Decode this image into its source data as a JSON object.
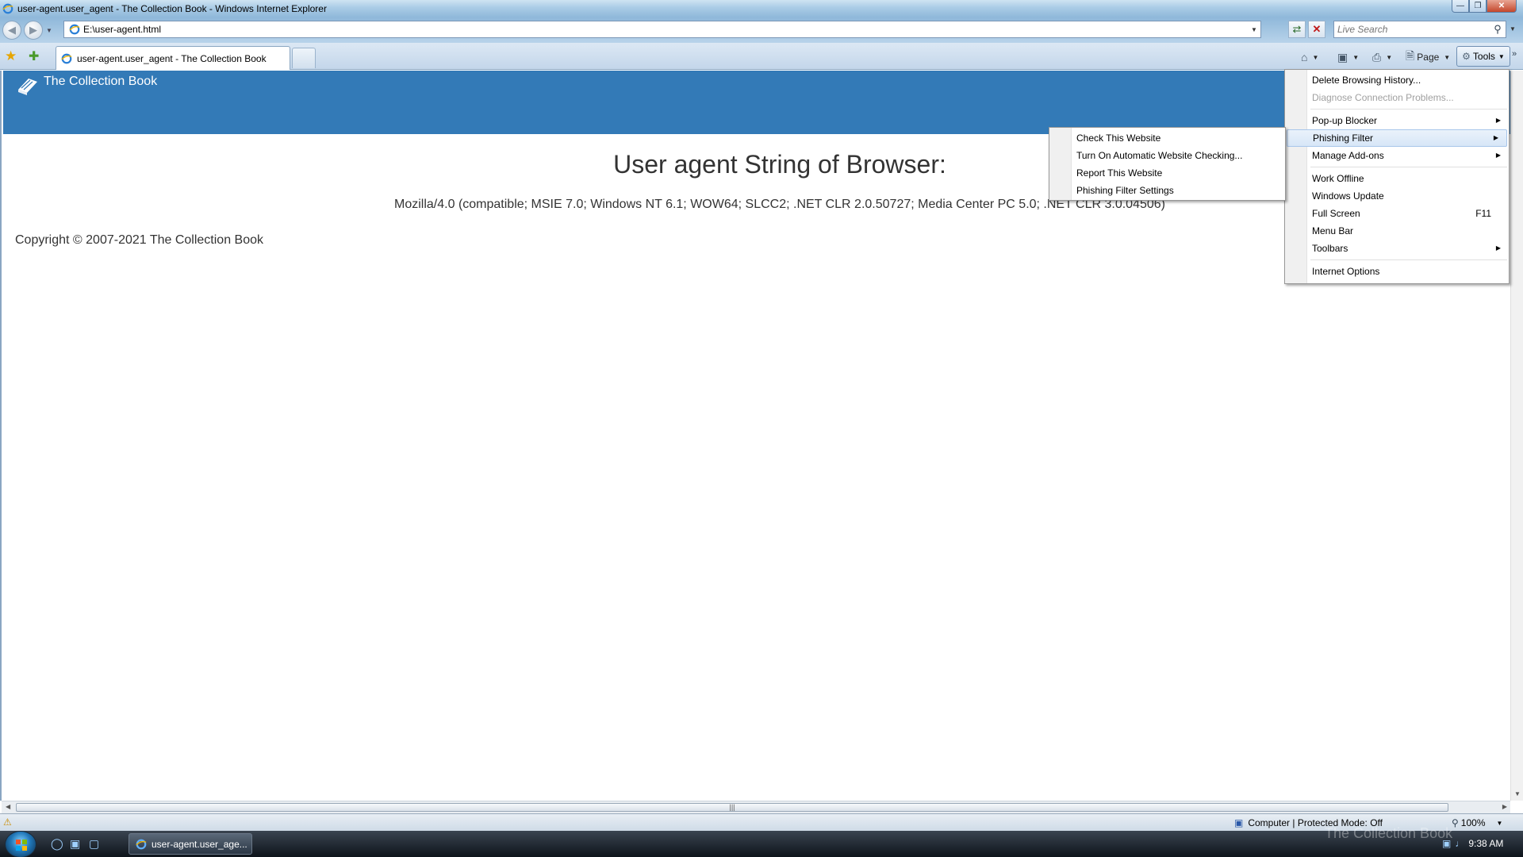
{
  "window": {
    "title": "user-agent.user_agent - The Collection Book - Windows Internet Explorer"
  },
  "navigation": {
    "address": "E:\\user-agent.html",
    "search_placeholder": "Live Search"
  },
  "tabs": [
    {
      "label": "user-agent.user_agent - The Collection Book"
    }
  ],
  "command_bar": {
    "page_label": "Page",
    "tools_label": "Tools"
  },
  "site": {
    "name": "The Collection Book",
    "heading": "User agent String of Browser:",
    "user_agent": "Mozilla/4.0 (compatible; MSIE 7.0; Windows NT 6.1; WOW64; SLCC2; .NET CLR 2.0.50727; Media Center PC 5.0; .NET CLR 3.0.04506)",
    "copyright": "Copyright © 2007-2021 The Collection Book"
  },
  "tools_menu": {
    "items": [
      {
        "label": "Delete Browsing History..."
      },
      {
        "label": "Diagnose Connection Problems..."
      },
      {
        "label": "Pop-up Blocker"
      },
      {
        "label": "Phishing Filter"
      },
      {
        "label": "Manage Add-ons"
      },
      {
        "label": "Work Offline"
      },
      {
        "label": "Windows Update"
      },
      {
        "label": "Full Screen",
        "shortcut": "F11"
      },
      {
        "label": "Menu Bar"
      },
      {
        "label": "Toolbars"
      },
      {
        "label": "Internet Options"
      }
    ]
  },
  "phishing_submenu": {
    "items": [
      {
        "label": "Check This Website"
      },
      {
        "label": "Turn On Automatic Website Checking..."
      },
      {
        "label": "Report This Website"
      },
      {
        "label": "Phishing Filter Settings"
      }
    ]
  },
  "status_bar": {
    "zone": "Computer | Protected Mode: Off",
    "zoom": "100%"
  },
  "taskbar": {
    "window_button": "user-agent.user_age...",
    "clock": "9:38 AM"
  },
  "watermark": "The Collection Book",
  "colors": {
    "site_header": "#337ab7",
    "menu_highlight": "#d7e6f7"
  },
  "icons": {
    "app": "ie-icon",
    "favorites": "star-icon",
    "add_favorite": "add-favorite-icon",
    "home": "home-icon",
    "feeds": "rss-icon",
    "print": "printer-icon",
    "page": "page-icon",
    "tools": "gear-icon",
    "search": "search-icon",
    "refresh": "refresh-icon",
    "stop": "stop-icon",
    "logo": "book-icon"
  }
}
